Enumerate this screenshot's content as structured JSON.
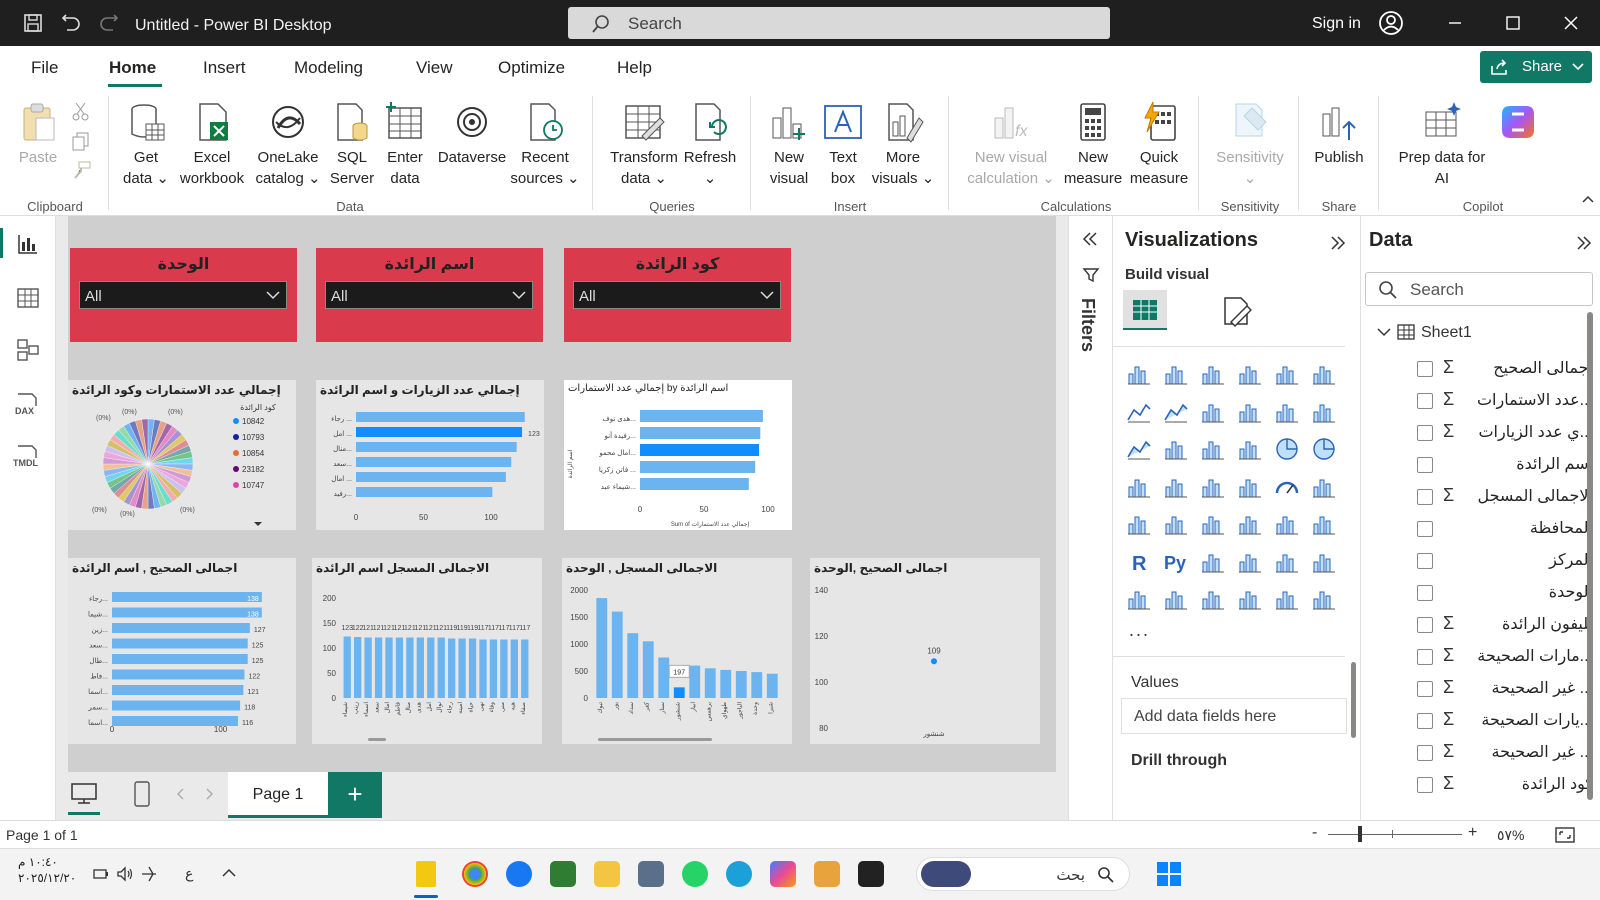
{
  "titlebar": {
    "title": "Untitled - Power BI Desktop",
    "search_placeholder": "Search",
    "sign_in": "Sign in"
  },
  "menu": {
    "items": [
      "File",
      "Home",
      "Insert",
      "Modeling",
      "View",
      "Optimize",
      "Help"
    ],
    "active": "Home",
    "share": "Share"
  },
  "ribbon": {
    "paste": "Paste",
    "get_data": [
      "Get",
      "data ⌄"
    ],
    "excel": [
      "Excel",
      "workbook"
    ],
    "onelake": [
      "OneLake",
      "catalog ⌄"
    ],
    "sql": [
      "SQL",
      "Server"
    ],
    "enter_data": [
      "Enter",
      "data"
    ],
    "dataverse": "Dataverse",
    "recent": [
      "Recent",
      "sources ⌄"
    ],
    "transform": [
      "Transform",
      "data ⌄"
    ],
    "refresh": [
      "Refresh",
      "⌄"
    ],
    "new_visual": [
      "New",
      "visual"
    ],
    "text_box": [
      "Text",
      "box"
    ],
    "more_visuals": [
      "More",
      "visuals ⌄"
    ],
    "new_visual_calc": [
      "New visual",
      "calculation ⌄"
    ],
    "new_measure": [
      "New",
      "measure"
    ],
    "quick_measure": [
      "Quick",
      "measure"
    ],
    "sensitivity": [
      "Sensitivity",
      "⌄"
    ],
    "publish": "Publish",
    "prep_copilot": [
      "Prep data for",
      "AI"
    ],
    "copilot": "Copilot",
    "groups": {
      "clipboard": "Clipboard",
      "data": "Data",
      "queries": "Queries",
      "insert": "Insert",
      "calculations": "Calculations",
      "sensitivity": "Sensitivity",
      "share": "Share",
      "copilot": "Copilot"
    }
  },
  "slicers": [
    {
      "title": "الوحدة",
      "value": "All"
    },
    {
      "title": "اسم الرائدة",
      "value": "All"
    },
    {
      "title": "كود الرائدة",
      "value": "All"
    }
  ],
  "visuals": {
    "pie": {
      "title": "إجمالي عدد الاستمارات وكود الرائدة",
      "legend_title": "كود الرائدة",
      "legend": [
        {
          "label": "10842",
          "color": "#118dff"
        },
        {
          "label": "10793",
          "color": "#12239e"
        },
        {
          "label": "10854",
          "color": "#e66c37"
        },
        {
          "label": "23182",
          "color": "#6b007b"
        },
        {
          "label": "10747",
          "color": "#e044a7"
        }
      ],
      "pct_labels": [
        "(0%)",
        "(0%)",
        "(0%)",
        "(0%)",
        "(0%)",
        "(0%)"
      ]
    },
    "visits": {
      "title": "إجمالي عدد الزيارات و اسم الرائدة",
      "data_label": "123"
    },
    "forms_by_name": {
      "title": "اسم الرائدة by إجمالي عدد الاستمارات",
      "xlabel": "Sum of إجمالي عدد الاستمارات",
      "ylabel": "اسم الرائدة"
    },
    "correct_by_name": {
      "title": "اجمالى الصحيح , اسم الرائدة"
    },
    "registered_by_name": {
      "title": "الاجمالى المسجل اسم الرائدة"
    },
    "registered_by_unit": {
      "title": "الاجمالى المسجل , الوحدة"
    },
    "correct_by_unit": {
      "title": "اجمالى الصحيح ,الوحدة"
    }
  },
  "chart_data": [
    {
      "type": "pie",
      "title": "إجمالي عدد الاستمارات وكود الرائدة",
      "legend_title": "كود الرائدة",
      "categories": [
        "10842",
        "10793",
        "10854",
        "23182",
        "10747"
      ]
    },
    {
      "type": "bar",
      "title": "إجمالي عدد الزيارات و اسم الرائدة",
      "categories": [
        "رجاء ...",
        "امل ...",
        "منال...",
        "سعد...",
        "امال ...",
        "رفيد..."
      ],
      "values": [
        125,
        123,
        119,
        115,
        111,
        101
      ],
      "xlim": [
        0,
        120
      ],
      "xticks": [
        "0",
        "50",
        "100"
      ]
    },
    {
      "type": "bar",
      "title": "اسم الرائدة by إجمالي عدد الاستمارات",
      "xlabel": "Sum of إجمالي عدد الاستمارات",
      "ylabel": "اسم الرائدة",
      "categories": [
        "هدى توف...",
        "رفيدة أنو...",
        "امال محمو...",
        "فاتن زكريا ...",
        "شيماء عبد..."
      ],
      "values": [
        96,
        94,
        93,
        90,
        85
      ],
      "xlim": [
        0,
        100
      ],
      "xticks": [
        "0",
        "50",
        "100"
      ]
    },
    {
      "type": "bar",
      "title": "اجمالى الصحيح , اسم الرائدة",
      "categories": [
        "رجاء...",
        "شيما...",
        "زين...",
        "سعد...",
        "طال...",
        "فاط...",
        "اسما...",
        "سمر...",
        "اسما..."
      ],
      "values": [
        138,
        138,
        127,
        125,
        125,
        122,
        121,
        118,
        116
      ],
      "xlim": [
        0,
        140
      ],
      "xticks": [
        "0",
        "100"
      ]
    },
    {
      "type": "bar",
      "title": "الاجمالى المسجل اسم الرائدة",
      "categories": [
        "شيماء",
        "زينب",
        "اسماء",
        "سعد",
        "امال",
        "فاطم",
        "منال",
        "هدى",
        "امل",
        "نوال",
        "رجاء",
        "امينة",
        "حياة",
        "نهى",
        "وفاء",
        "منى",
        "هبه",
        "صفاء"
      ],
      "values": [
        123,
        122,
        121,
        121,
        121,
        121,
        121,
        121,
        121,
        121,
        119,
        119,
        119,
        117,
        117,
        117,
        117,
        117
      ],
      "data_labels": [
        "123",
        "122",
        "121",
        "121",
        "121",
        "121",
        "121",
        "121",
        "121",
        "121",
        "119",
        "119",
        "119",
        "117",
        "117",
        "117",
        "117",
        "117"
      ],
      "ylim": [
        0,
        200
      ],
      "yticks": [
        "0",
        "50",
        "100",
        "150",
        "200"
      ]
    },
    {
      "type": "bar",
      "title": "الاجمالى المسجل , الوحدة",
      "categories": [
        "تبوك",
        "بور",
        "سداد",
        "كفر",
        "سنار",
        "شنشور",
        "ابيار",
        "برهمس",
        "طهواي",
        "الباجور",
        "وحدة",
        "شبرا"
      ],
      "values": [
        1850,
        1600,
        1200,
        1050,
        750,
        197,
        600,
        550,
        520,
        500,
        480,
        450
      ],
      "data_labels": [
        "197"
      ],
      "ylim": [
        0,
        2000
      ],
      "yticks": [
        "0",
        "500",
        "1000",
        "1500",
        "2000"
      ]
    },
    {
      "type": "scatter",
      "title": "اجمالى الصحيح ,الوحدة",
      "categories": [
        "شنشور"
      ],
      "values": [
        109
      ],
      "data_labels": [
        "109"
      ],
      "ylim": [
        80,
        140
      ],
      "yticks": [
        "80",
        "100",
        "120",
        "140"
      ]
    }
  ],
  "pages": {
    "tab": "Page 1",
    "status": "Page 1 of 1",
    "zoom": "٥٧%"
  },
  "filters": {
    "label": "Filters"
  },
  "visualizations": {
    "title": "Visualizations",
    "build_visual": "Build visual",
    "more": "...",
    "values_label": "Values",
    "add_fields": "Add data fields here",
    "drill_through": "Drill through"
  },
  "data_pane": {
    "title": "Data",
    "search_placeholder": "Search",
    "table": "Sheet1",
    "fields": [
      {
        "name": "اجمالى الصحيح",
        "sigma": true
      },
      {
        "name": "...عدد الاستمارات",
        "sigma": true
      },
      {
        "name": "...ي عدد الزيارات",
        "sigma": true
      },
      {
        "name": "اسم الرائدة",
        "sigma": false
      },
      {
        "name": "الاجمالى المسجل",
        "sigma": true
      },
      {
        "name": "المحافظة",
        "sigma": false
      },
      {
        "name": "المركز",
        "sigma": false
      },
      {
        "name": "الوحدة",
        "sigma": false
      },
      {
        "name": "تليفون الرائدة",
        "sigma": true
      },
      {
        "name": "...مارات الصحيحة",
        "sigma": true
      },
      {
        "name": "... غير الصحيحة",
        "sigma": true
      },
      {
        "name": "...يارات الصحيحة",
        "sigma": true
      },
      {
        "name": "... غير الصحيحة",
        "sigma": true
      },
      {
        "name": "كود الرائدة",
        "sigma": true
      }
    ]
  },
  "taskbar": {
    "time": "١٠:٤٠ م",
    "date": "٢٠٢٥/١٢/٢٠",
    "lang": "ع",
    "search": "بحث"
  },
  "colors": {
    "accent": "#117865",
    "slicer": "#d93b4d",
    "bar": "#6cb4f0",
    "bar_highlight": "#118dff"
  }
}
